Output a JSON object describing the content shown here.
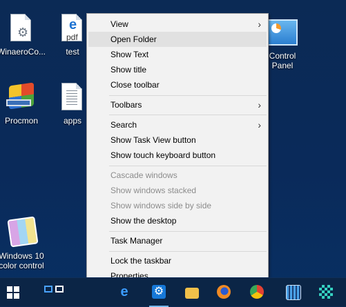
{
  "desktop": {
    "icons": [
      {
        "label": "WinaeroCo...",
        "icon": "settings-file-icon"
      },
      {
        "label": "test",
        "icon": "pdf-file-icon",
        "badge": "pdf"
      },
      {
        "label": "Procmon",
        "icon": "procmon-icon"
      },
      {
        "label": "apps",
        "icon": "text-file-icon"
      },
      {
        "label": "Windows 10",
        "label2": "color control",
        "icon": "color-control-icon"
      },
      {
        "label": "Control",
        "label2": "Panel",
        "icon": "control-panel-icon"
      }
    ]
  },
  "menu": {
    "items": [
      {
        "label": "View",
        "submenu": true
      },
      {
        "label": "Open Folder",
        "highlighted": true
      },
      {
        "label": "Show Text"
      },
      {
        "label": "Show title"
      },
      {
        "label": "Close toolbar"
      },
      {
        "label": "Toolbars",
        "submenu": true
      },
      {
        "label": "Search",
        "submenu": true
      },
      {
        "label": "Show Task View button"
      },
      {
        "label": "Show touch keyboard button"
      },
      {
        "label": "Cascade windows",
        "disabled": true
      },
      {
        "label": "Show windows stacked",
        "disabled": true
      },
      {
        "label": "Show windows side by side",
        "disabled": true
      },
      {
        "label": "Show the desktop"
      },
      {
        "label": "Task Manager"
      },
      {
        "label": "Lock the taskbar"
      },
      {
        "label": "Properties"
      }
    ],
    "chevron": "›"
  },
  "taskbar": {
    "items": [
      {
        "icon": "start-icon"
      },
      {
        "icon": "task-view-icon"
      },
      {
        "icon": "edge-icon",
        "glyph": "e"
      },
      {
        "icon": "settings-icon",
        "glyph": "⚙"
      },
      {
        "icon": "file-explorer-icon"
      },
      {
        "icon": "firefox-icon"
      },
      {
        "icon": "chrome-icon"
      },
      {
        "icon": "tool-icon"
      },
      {
        "icon": "app-icon"
      }
    ]
  },
  "colors": {
    "desktop": "#0b2a55",
    "menu_bg": "#f2f2f2",
    "menu_highlight": "#e1e1e1",
    "menu_disabled": "#8c8c8c",
    "taskbar": "#0b2546"
  }
}
